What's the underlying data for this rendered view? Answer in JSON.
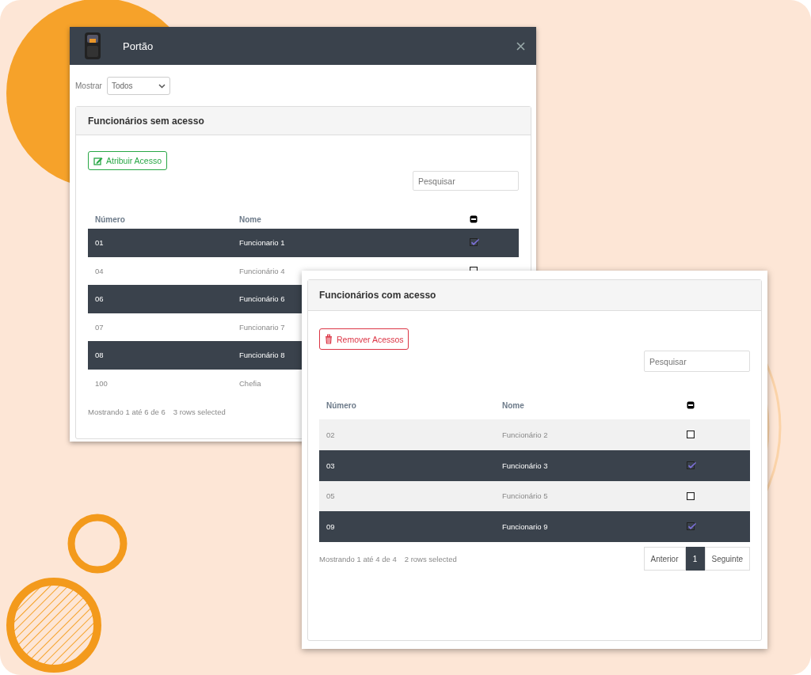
{
  "dialog": {
    "title": "Portão",
    "filter": {
      "label": "Mostrar",
      "value": "Todos"
    },
    "panel": {
      "title": "Funcionários sem acesso",
      "action": {
        "kind": "assign",
        "label": "Atribuir Acesso"
      },
      "search": {
        "placeholder": "Pesquisar"
      },
      "columns": [
        "Número",
        "Nome"
      ],
      "rows": [
        {
          "number": "01",
          "name": "Funcionario 1",
          "selected": true
        },
        {
          "number": "04",
          "name": "Funcionário 4",
          "selected": false
        },
        {
          "number": "06",
          "name": "Funcionário 6",
          "selected": true
        },
        {
          "number": "07",
          "name": "Funcionario 7",
          "selected": false
        },
        {
          "number": "08",
          "name": "Funcionário 8",
          "selected": true
        },
        {
          "number": "100",
          "name": "Chefia",
          "selected": false
        }
      ],
      "info": "Mostrando 1 até 6 de 6",
      "selection_info": "3 rows selected"
    }
  },
  "overlay_panel": {
    "title": "Funcionários com acesso",
    "action": {
      "kind": "remove",
      "label": "Remover Acessos"
    },
    "search": {
      "placeholder": "Pesquisar"
    },
    "columns": [
      "Número",
      "Nome"
    ],
    "rows": [
      {
        "number": "02",
        "name": "Funcionário 2",
        "selected": false
      },
      {
        "number": "03",
        "name": "Funcionário 3",
        "selected": true
      },
      {
        "number": "05",
        "name": "Funcionário 5",
        "selected": false
      },
      {
        "number": "09",
        "name": "Funcionario 9",
        "selected": true
      }
    ],
    "info": "Mostrando 1 até 4 de 4",
    "selection_info": "2 rows selected",
    "pagination": [
      {
        "label": "Anterior",
        "selected": false
      },
      {
        "label": "1",
        "selected": true
      },
      {
        "label": "Seguinte",
        "selected": false
      }
    ]
  }
}
